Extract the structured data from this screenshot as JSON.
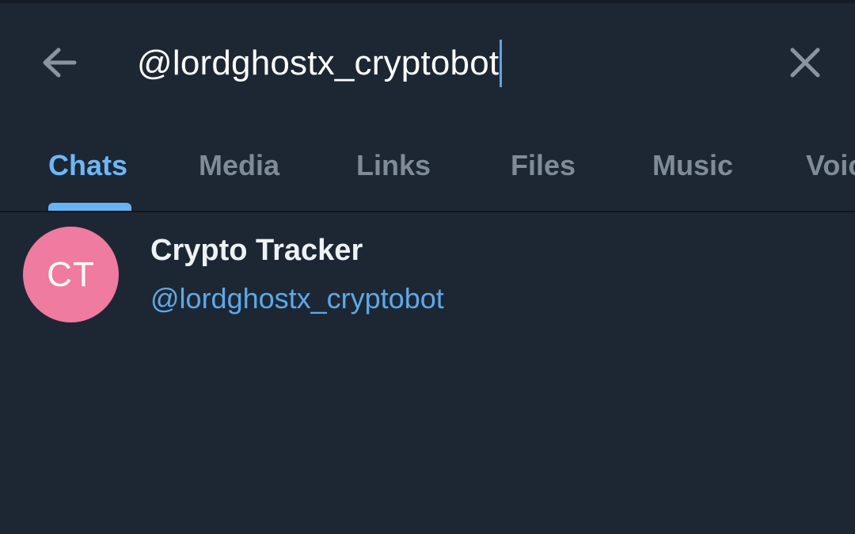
{
  "search": {
    "query": "@lordghostx_cryptobot",
    "back_icon": "arrow-left-icon",
    "clear_icon": "close-icon"
  },
  "tabs": [
    {
      "label": "Chats",
      "active": true
    },
    {
      "label": "Media",
      "active": false
    },
    {
      "label": "Links",
      "active": false
    },
    {
      "label": "Files",
      "active": false
    },
    {
      "label": "Music",
      "active": false
    },
    {
      "label": "Voice",
      "active": false
    }
  ],
  "results": [
    {
      "initials": "CT",
      "title": "Crypto Tracker",
      "username": "@lordghostx_cryptobot",
      "avatar_color": "#ef7ba0"
    }
  ],
  "colors": {
    "background": "#1d2733",
    "accent": "#6fb6f5",
    "link": "#5ea8e8",
    "tab_inactive": "#7f8b97"
  }
}
